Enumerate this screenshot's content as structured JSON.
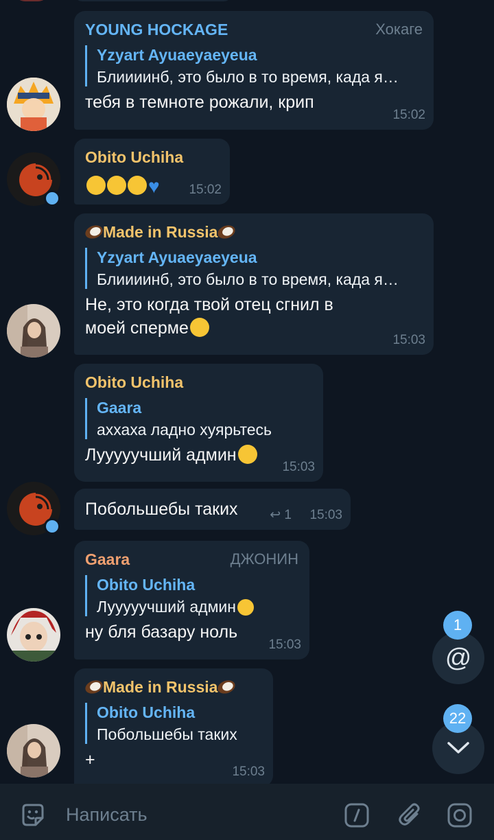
{
  "messages": [
    {
      "sender": "YOUNG HOCKAGE",
      "sender_color": "#64b5f6",
      "rank": "Хокаге",
      "reply_name": "Yzyart Ayuaeyaeyeua",
      "reply_text": "Блиииинб, это было в то время, када я…",
      "text": "тебя в темноте рожали, крип",
      "time": "15:02"
    },
    {
      "sender": "Obito Uchiha",
      "sender_color": "#f2c36b",
      "text": "",
      "time": "15:02"
    },
    {
      "sender": "Made in Russia",
      "sender_color": "#f2c36b",
      "reply_name": "Yzyart Ayuaeyaeyeua",
      "reply_text": "Блиииинб, это было в то время, када я…",
      "text_line1": "Не, это когда твой отец сгнил в",
      "text_line2": "моей сперме",
      "time": "15:03"
    },
    {
      "sender": "Obito Uchiha",
      "sender_color": "#f2c36b",
      "reply_name": "Gaara",
      "reply_text": "аххаха ладно хуярьтесь",
      "text": "Лууууучший админ",
      "time": "15:03"
    },
    {
      "text": "Побольшебы таких",
      "reply_count": "1",
      "time": "15:03"
    },
    {
      "sender": "Gaara",
      "sender_color": "#f0a070",
      "rank": "ДЖОНИН",
      "reply_name": "Obito Uchiha",
      "reply_text": "Лууууучший админ",
      "text": "ну бля базару ноль",
      "time": "15:03"
    },
    {
      "sender": "Made in Russia",
      "sender_color": "#f2c36b",
      "reply_name": "Obito Uchiha",
      "reply_text": "Побольшебы таких",
      "text": "+",
      "time": "15:03"
    }
  ],
  "mentions": {
    "count": "1"
  },
  "unread": {
    "count": "22"
  },
  "composer": {
    "placeholder": "Написать",
    "icons": [
      "emoji-icon",
      "command-icon",
      "attach-icon",
      "camera-icon"
    ]
  },
  "colors": {
    "bg": "#0e1621",
    "bubble": "#182533",
    "accent": "#5fb1f2"
  }
}
